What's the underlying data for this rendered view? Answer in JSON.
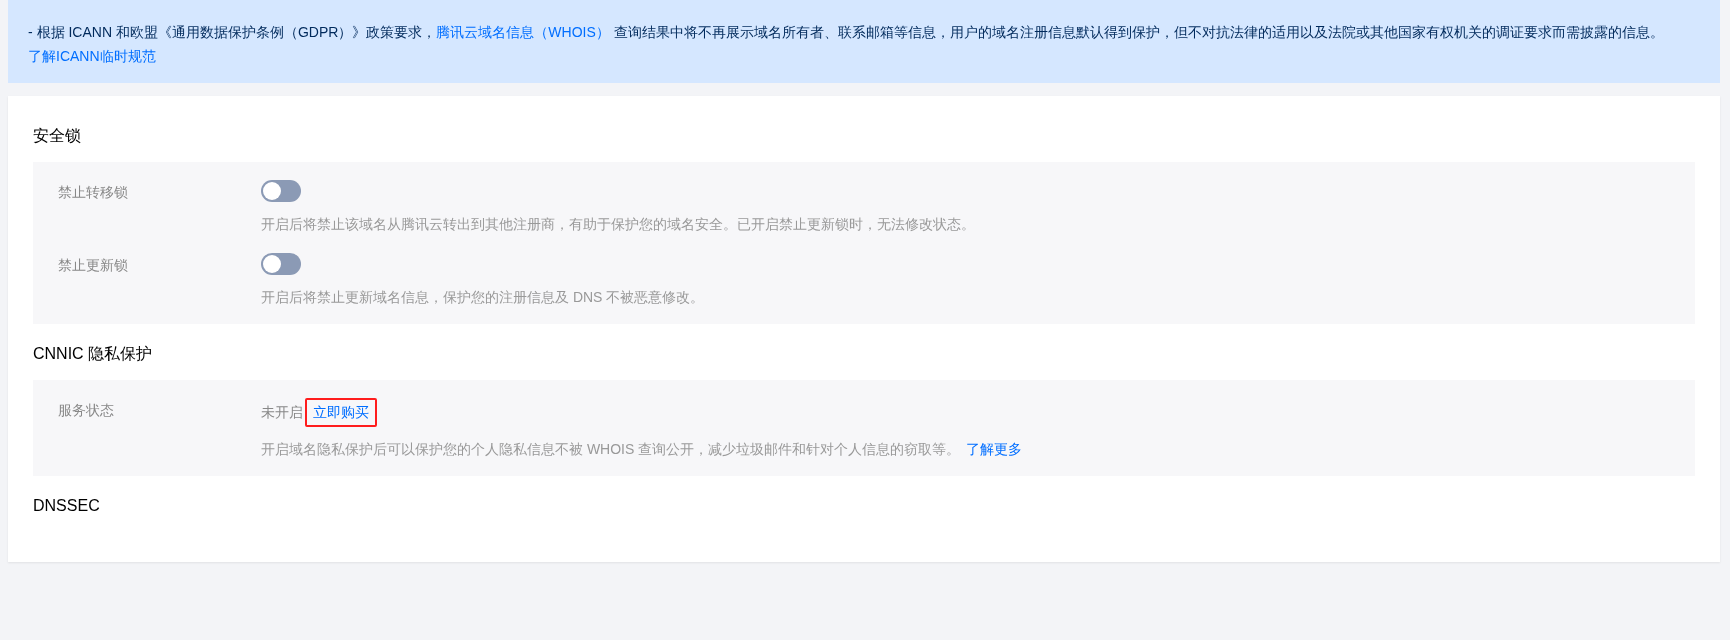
{
  "notice": {
    "parts": [
      {
        "kind": "text",
        "text": "- 根据 ICANN 和欧盟《通用数据保护条例（GDPR）》政策要求，"
      },
      {
        "kind": "link",
        "text": "腾讯云域名信息（WHOIS）"
      },
      {
        "kind": "text",
        "text": " 查询结果中将不再展示域名所有者、联系邮箱等信息，用户的域名注册信息默认得到保护，但不对抗法律的适用以及法院或其他国家有权机关的调证要求而需披露的信息。"
      },
      {
        "kind": "link",
        "text": "了解ICANN临时规范"
      }
    ]
  },
  "sections": [
    {
      "title": "安全锁",
      "kind": "toggles",
      "rows": [
        {
          "label": "禁止转移锁",
          "on": false,
          "description": "开启后将禁止该域名从腾讯云转出到其他注册商，有助于保护您的域名安全。已开启禁止更新锁时，无法修改状态。"
        },
        {
          "label": "禁止更新锁",
          "on": false,
          "description": "开启后将禁止更新域名信息，保护您的注册信息及 DNS 不被恶意修改。"
        }
      ]
    },
    {
      "title": "CNNIC 隐私保护",
      "kind": "service",
      "rows": [
        {
          "label": "服务状态",
          "status": "未开启",
          "link": {
            "text": "立即购买",
            "highlighted": true
          },
          "description": "开启域名隐私保护后可以保护您的个人隐私信息不被 WHOIS 查询公开，减少垃圾邮件和针对个人信息的窃取等。",
          "more_link": "了解更多"
        }
      ]
    },
    {
      "title": "DNSSEC",
      "kind": "empty"
    }
  ]
}
